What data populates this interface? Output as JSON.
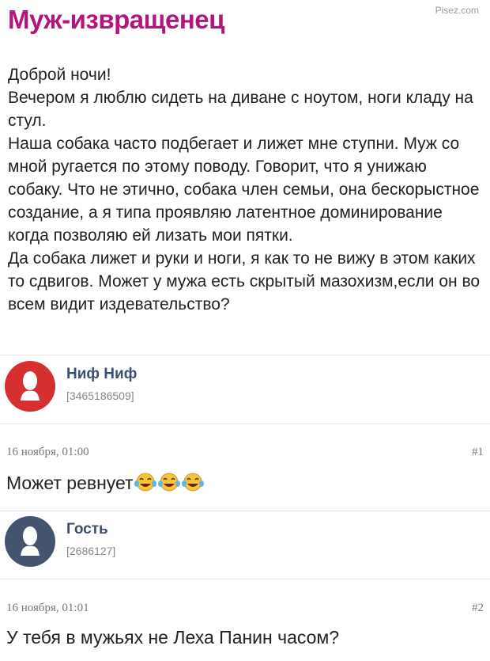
{
  "title": "Муж-извращенец",
  "watermark": "Pisez.com",
  "post": {
    "lines": [
      "Доброй ночи!",
      "Вечером я люблю сидеть на диване с ноутом, ноги кладу на стул.",
      "Наша собака часто подбегает и лижет мне ступни. Муж со мной ругается по этому поводу. Говорит, что я унижаю собаку. Что не этично, собака член семьи, она бескорыстное создание, а я типа проявляю латентное доминирование когда позволяю ей лизать мои пятки.",
      "Да собака лижет и руки и ноги, я как то не вижу в этом каких то сдвигов. Может у мужа есть скрытый мазохизм,если он во всем видит издевательство?"
    ]
  },
  "comments": [
    {
      "author": "Ниф Ниф",
      "user_id": "[3465186509]",
      "avatar_color": "#d62f2f",
      "date": "16 ноября, 01:00",
      "number": "#1",
      "text": "Может ревнует",
      "emoji": "face-with-tears-of-joy x3"
    },
    {
      "author": "Гость",
      "user_id": "[2686127]",
      "avatar_color": "#44546e",
      "date": "16 ноября, 01:01",
      "number": "#2",
      "text": "У тебя в мужьях не Леха Панин часом?"
    }
  ]
}
